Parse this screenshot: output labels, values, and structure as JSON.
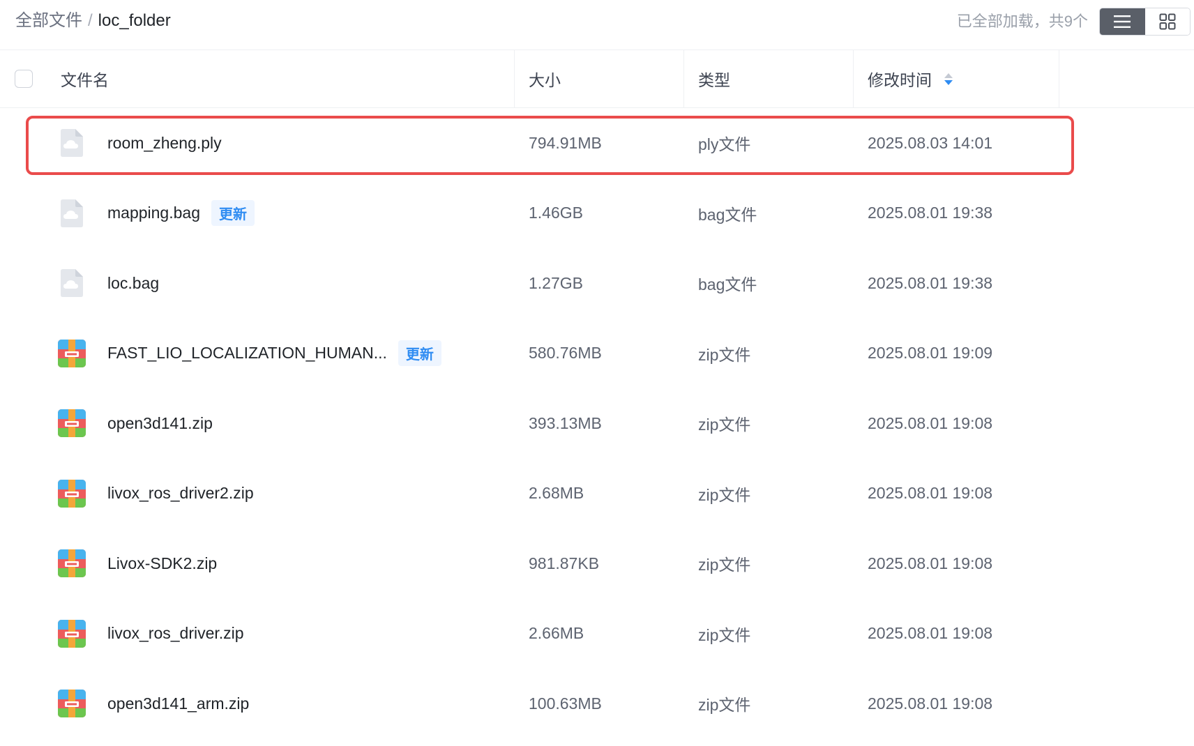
{
  "breadcrumb": {
    "root": "全部文件",
    "separator": "/",
    "current": "loc_folder"
  },
  "status": {
    "loaded_text": "已全部加载，共9个"
  },
  "table": {
    "headers": {
      "name": "文件名",
      "size": "大小",
      "type": "类型",
      "modified": "修改时间"
    },
    "sort": {
      "column": "modified",
      "direction": "desc"
    },
    "rows": [
      {
        "name": "room_zheng.ply",
        "badge": "",
        "size": "794.91MB",
        "type": "ply文件",
        "modified": "2025.08.03 14:01",
        "icon": "cloud-file-icon",
        "highlighted": true
      },
      {
        "name": "mapping.bag",
        "badge": "更新",
        "size": "1.46GB",
        "type": "bag文件",
        "modified": "2025.08.01 19:38",
        "icon": "cloud-file-icon",
        "highlighted": false
      },
      {
        "name": "loc.bag",
        "badge": "",
        "size": "1.27GB",
        "type": "bag文件",
        "modified": "2025.08.01 19:38",
        "icon": "cloud-file-icon",
        "highlighted": false
      },
      {
        "name": "FAST_LIO_LOCALIZATION_HUMAN...",
        "badge": "更新",
        "size": "580.76MB",
        "type": "zip文件",
        "modified": "2025.08.01 19:09",
        "icon": "zip-archive-icon",
        "highlighted": false
      },
      {
        "name": "open3d141.zip",
        "badge": "",
        "size": "393.13MB",
        "type": "zip文件",
        "modified": "2025.08.01 19:08",
        "icon": "zip-archive-icon",
        "highlighted": false
      },
      {
        "name": "livox_ros_driver2.zip",
        "badge": "",
        "size": "2.68MB",
        "type": "zip文件",
        "modified": "2025.08.01 19:08",
        "icon": "zip-archive-icon",
        "highlighted": false
      },
      {
        "name": "Livox-SDK2.zip",
        "badge": "",
        "size": "981.87KB",
        "type": "zip文件",
        "modified": "2025.08.01 19:08",
        "icon": "zip-archive-icon",
        "highlighted": false
      },
      {
        "name": "livox_ros_driver.zip",
        "badge": "",
        "size": "2.66MB",
        "type": "zip文件",
        "modified": "2025.08.01 19:08",
        "icon": "zip-archive-icon",
        "highlighted": false
      },
      {
        "name": "open3d141_arm.zip",
        "badge": "",
        "size": "100.63MB",
        "type": "zip文件",
        "modified": "2025.08.01 19:08",
        "icon": "zip-archive-icon",
        "highlighted": false
      }
    ]
  },
  "view_toggle": {
    "active": "list",
    "icons": [
      "list-view-icon",
      "grid-view-icon"
    ]
  },
  "colors": {
    "accent": "#2f8cf2",
    "highlight_border": "#ea4b4b",
    "toggle_active": "#5a5f68"
  }
}
